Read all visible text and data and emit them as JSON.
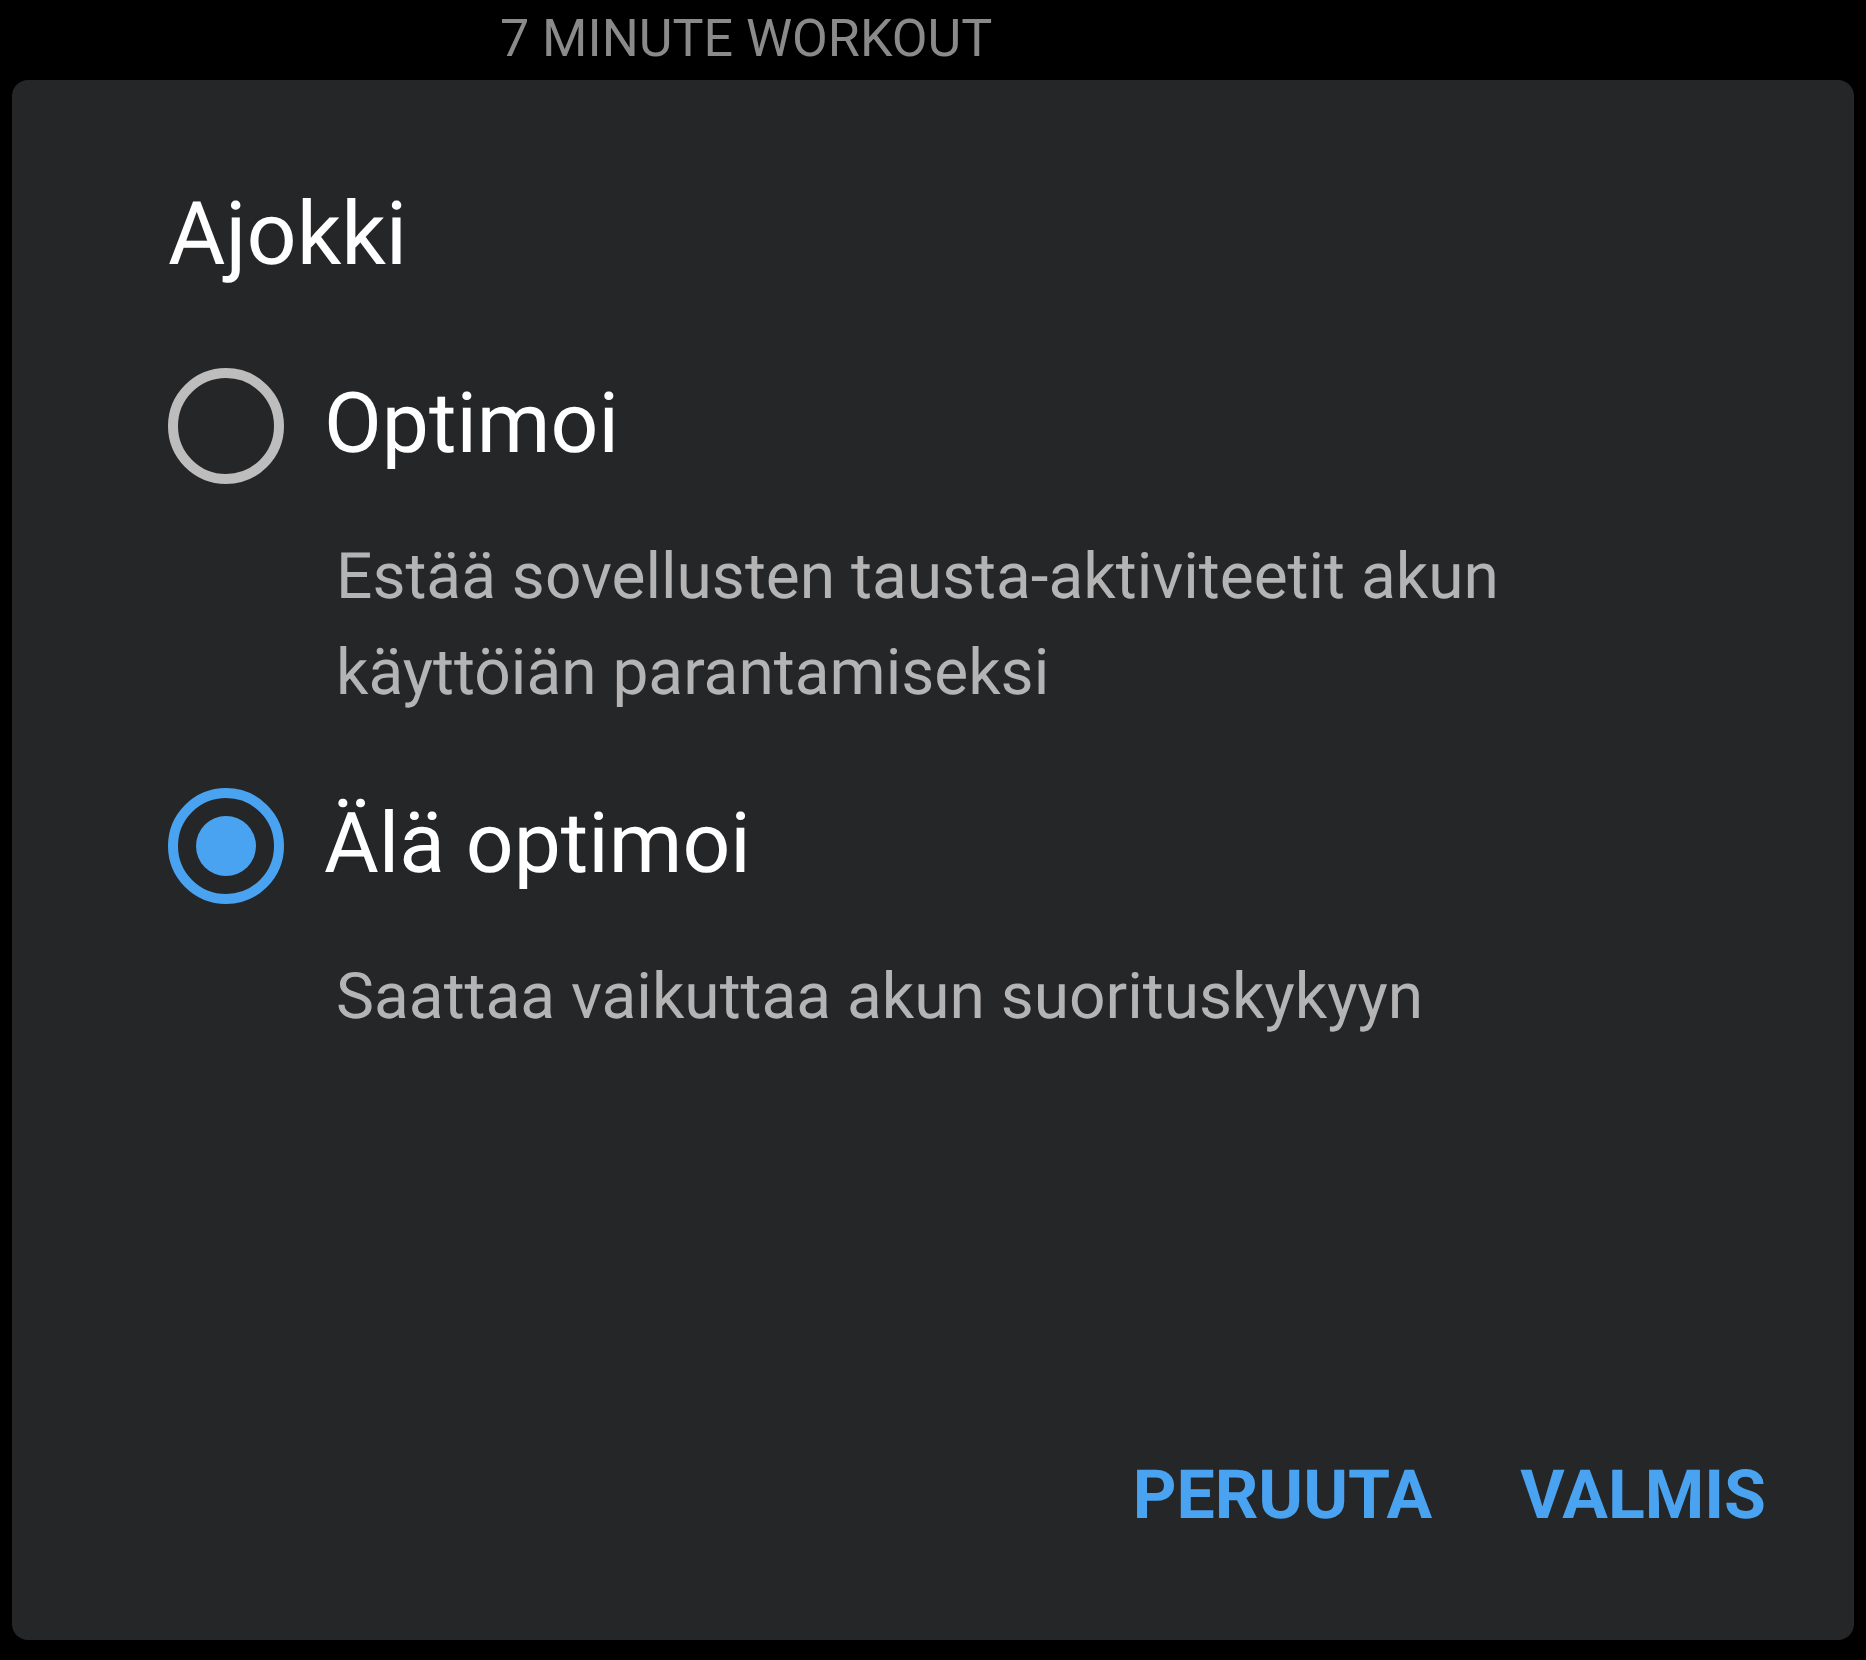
{
  "background": {
    "title": "7 MINUTE WORKOUT"
  },
  "dialog": {
    "title": "Ajokki",
    "options": [
      {
        "label": "Optimoi",
        "description": "Estää sovellusten tausta-aktiviteetit akun käyttöiän parantamiseksi",
        "selected": false
      },
      {
        "label": "Älä optimoi",
        "description": "Saattaa vaikuttaa akun suorituskykyyn",
        "selected": true
      }
    ],
    "buttons": [
      "PERUUTA",
      "VALMIS"
    ]
  }
}
